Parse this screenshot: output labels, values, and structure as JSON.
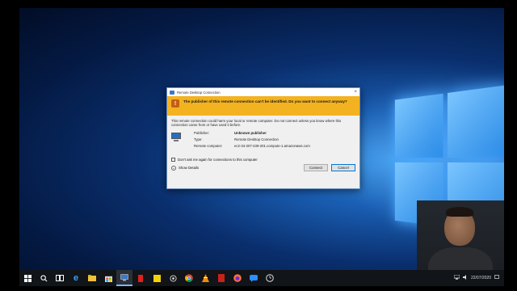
{
  "dialog": {
    "title": "Remote Desktop Connection",
    "warning": "The publisher of this remote connection can't be identified. Do you want to connect anyway?",
    "body": "This remote connection could harm your local or remote computer. Do not connect unless you know where this connection came from or have used it before.",
    "fields": [
      {
        "key": "Publisher:",
        "value": "Unknown publisher",
        "bold": true
      },
      {
        "key": "Type:",
        "value": "Remote Desktop Connection",
        "bold": false
      },
      {
        "key": "Remote computer:",
        "value": "ec2-34-207-239-201.compute-1.amazonaws.com",
        "bold": false
      }
    ],
    "checkbox_label": "Don't ask me again for connections to this computer",
    "show_details": "Show Details",
    "connect_label": "Connect",
    "cancel_label": "Cancel"
  },
  "taskbar": {
    "date": "22/07/2020"
  },
  "colors": {
    "warning_band": "#f3b220",
    "accent": "#0078d7"
  }
}
